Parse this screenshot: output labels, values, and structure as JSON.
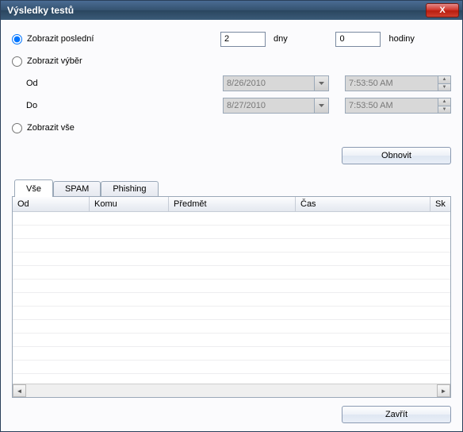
{
  "title": "Výsledky testů",
  "radios": {
    "last": "Zobrazit poslední",
    "range": "Zobrazit výběr",
    "all": "Zobrazit vše"
  },
  "last": {
    "days_value": "2",
    "days_unit": "dny",
    "hours_value": "0",
    "hours_unit": "hodiny"
  },
  "range": {
    "from_label": "Od",
    "to_label": "Do",
    "from_date": "8/26/2010",
    "to_date": "8/27/2010",
    "from_time": "7:53:50 AM",
    "to_time": "7:53:50 AM"
  },
  "buttons": {
    "refresh": "Obnovit",
    "close": "Zavřít"
  },
  "tabs": {
    "all": "Vše",
    "spam": "SPAM",
    "phishing": "Phishing"
  },
  "columns": {
    "from": "Od",
    "to": "Komu",
    "subject": "Předmět",
    "time": "Čas",
    "sk": "Sk"
  }
}
